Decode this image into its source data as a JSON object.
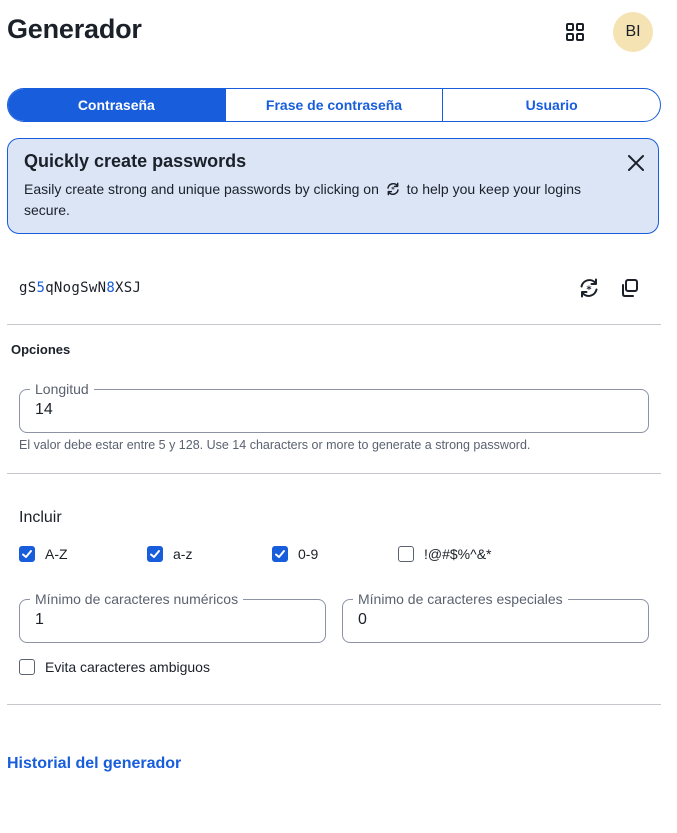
{
  "header": {
    "title": "Generador",
    "avatar_initials": "BI",
    "grid_icon": "grid-icon"
  },
  "tabs": [
    {
      "label": "Contraseña",
      "active": true
    },
    {
      "label": "Frase de contraseña",
      "active": false
    },
    {
      "label": "Usuario",
      "active": false
    }
  ],
  "callout": {
    "title": "Quickly create passwords",
    "body_before": "Easily create strong and unique passwords by clicking on",
    "body_after": "to help you keep your logins secure.",
    "close_icon": "close-icon"
  },
  "password": {
    "part1": "gS",
    "part2": "5",
    "part3": "qNogSwN",
    "part4": "8",
    "part5": "XSJ",
    "regenerate_icon": "regenerate-icon",
    "copy_icon": "copy-icon"
  },
  "options": {
    "title": "Opciones",
    "length_label": "Longitud",
    "length_value": "14",
    "length_hint": "El valor debe estar entre 5 y 128. Use 14 characters or more to generate a strong password.",
    "include_label": "Incluir",
    "checkboxes": [
      {
        "label": "A-Z",
        "checked": true
      },
      {
        "label": "a-z",
        "checked": true
      },
      {
        "label": "0-9",
        "checked": true
      },
      {
        "label": "!@#$%^&*",
        "checked": false
      }
    ],
    "min_numbers_label": "Mínimo de caracteres numéricos",
    "min_numbers_value": "1",
    "min_special_label": "Mínimo de caracteres especiales",
    "min_special_value": "0",
    "avoid_ambiguous_label": "Evita caracteres ambiguos",
    "avoid_ambiguous_checked": false
  },
  "footer": {
    "history_link": "Historial del generador"
  },
  "colors": {
    "primary": "#175ddc",
    "callout_bg": "#dbe5f6",
    "avatar_bg": "#f6e3b4"
  }
}
